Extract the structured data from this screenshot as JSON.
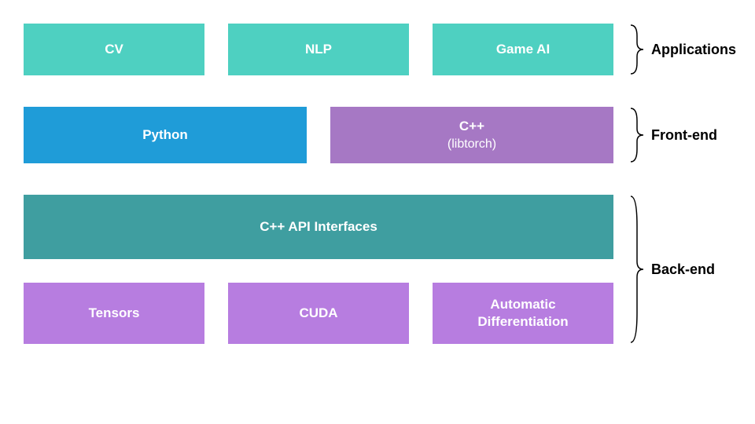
{
  "colors": {
    "teal": "#4ed0c1",
    "blue": "#1f9cd8",
    "purple": "#a678c4",
    "dark_teal": "#3f9ea0",
    "light_purple": "#b77de0"
  },
  "layers": {
    "applications": {
      "label": "Applications",
      "items": [
        "CV",
        "NLP",
        "Game AI"
      ]
    },
    "frontend": {
      "label": "Front-end",
      "items": [
        {
          "label": "Python"
        },
        {
          "label": "C++",
          "sublabel": "(libtorch)"
        }
      ]
    },
    "backend": {
      "label": "Back-end",
      "api_label": "C++ API Interfaces",
      "items": [
        "Tensors",
        "CUDA",
        "Automatic\nDifferentiation"
      ]
    }
  }
}
